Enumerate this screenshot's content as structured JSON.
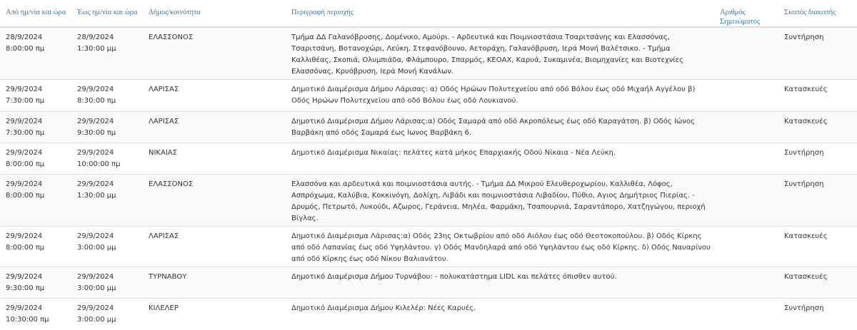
{
  "table": {
    "headers": {
      "from": "Από ημ/νία και ώρα",
      "to": "Έως ημ/νία και ώρα",
      "municipality": "Δήμος/κοινότητα",
      "area": "Περιγραφή περιοχής",
      "notice_number": "Αριθμός Σημειώματος",
      "purpose": "Σκοπός διακοπής"
    },
    "rows": [
      {
        "from_date": "28/9/2024",
        "from_time": "8:00:00 πμ",
        "to_date": "28/9/2024",
        "to_time": "1:30:00 μμ",
        "municipality": "ΕΛΑΣΣΟΝΟΣ",
        "area": "Τμήμα ΔΔ Γαλανόβρυσης, Δομένικο, Αμούρι. - Αρδευτικά και Ποιμνιοστάσια Τσαριτσάνης και Ελασσόνας, Τσαριτσάνη, Βοτανοχώρι, Λεύκη, Στεφανόβουνο, Αετοράχη, Γαλανόβρυση, Ιερά Μονή Βαλέτσικο. - Τμήμα Καλλιθέας, Σκοπιά, Ολυμπιάδα, Φλάμπουρο, Σπαρμός, ΚΕΟΑΧ, Καρυά, Συκαμινέα, Βιομηχανίες και Βιοτεχνίες Ελασσόνας, Κρυόβρυση, Ιερά Μονή Κανάλων.",
        "notice_number": "",
        "purpose": "Συντήρηση"
      },
      {
        "from_date": "29/9/2024",
        "from_time": "7:30:00 πμ",
        "to_date": "29/9/2024",
        "to_time": "8:30:00 πμ",
        "municipality": "ΛΑΡΙΣΑΣ",
        "area": "Δημοτικό Διαμέρισμα Δήμου Λάρισας: α) Οδός Ηρώων Πολυτεχνείου από οδό Βόλου έως οδό Μιχαήλ Αγγέλου β) Οδός Ηρώων Πολυτεχνείου από οδό Βόλου έως οδό Λουκιανού.",
        "notice_number": "",
        "purpose": "Κατασκευές"
      },
      {
        "from_date": "29/9/2024",
        "from_time": "7:30:00 πμ",
        "to_date": "29/9/2024",
        "to_time": "9:30:00 πμ",
        "municipality": "ΛΑΡΙΣΑΣ",
        "area": "Δημοτικό Διαμέρισμα Δήμου Λάρισας:α) Οδός Σαμαρά από οδό Ακροπόλεως έως οδό Καραγάτση. β) Οδός Ιώνος Βαρβάκη από οδός Σαμαρά έως Ιωνος Βαρβάκη 6.",
        "notice_number": "",
        "purpose": "Κατασκευές"
      },
      {
        "from_date": "29/9/2024",
        "from_time": "8:00:00 πμ",
        "to_date": "29/9/2024",
        "to_time": "10:00:00 πμ",
        "municipality": "ΝΙΚΑΙΑΣ",
        "area": "Δημοτικό Διαμέρισμα Νικαίας: πελάτες κατά μήκος Επαρχιακής Οδού Νίκαια - Νέα Λεύκη.",
        "notice_number": "",
        "purpose": "Συντήρηση"
      },
      {
        "from_date": "29/9/2024",
        "from_time": "8:00:00 πμ",
        "to_date": "29/9/2024",
        "to_time": "1:30:00 μμ",
        "municipality": "ΕΛΑΣΣΟΝΟΣ",
        "area": "Ελασσόνα και αρδευτικά και ποιμνιοστάσια αυτής. - Τμήμα ΔΔ Μικρού Ελευθεροχωρίου, Καλλιθέα, Λόφος, Ασπρόχωμα, Καλύβια, Κοκκινόγη, Δολίχη, Λιβάδι και ποιμνιοστάσια Λιβαδίου, Πύθιο, Αγιος Δημήτριος Πιερίας. - Δρυμός, Πετρωτό, Λυκούδι, Αζωρος, Γεράνεια, Μηλέα, Φαρμάκη, Τσαπουρνιά, Σαραντάπορο, Χατζηγώγου, περιοχή Βίγλας.",
        "notice_number": "",
        "purpose": "Συντήρηση"
      },
      {
        "from_date": "29/9/2024",
        "from_time": "8:00:00 πμ",
        "to_date": "29/9/2024",
        "to_time": "3:00:00 μμ",
        "municipality": "ΛΑΡΙΣΑΣ",
        "area": "Δημοτικό Διαμέρισμα Λάρισας:α) Οδός 23ης Οκτωβρίου από οδό Αιόλου έως οδό Θεοτοκοπούλου. β) Οδός Κίρκης από οδό Λαπανίας έως οδό Υψηλάντου. γ) Οδός Μανδηλαρά από οδό Υψηλάντου έως οδό Κίρκης. δ) Οδός Ναυαρίνου από οδό Κίρκης έως οδό Νίκου Βαλιανάτου.",
        "notice_number": "",
        "purpose": "Κατασκευές"
      },
      {
        "from_date": "29/9/2024",
        "from_time": "9:30:00 πμ",
        "to_date": "29/9/2024",
        "to_time": "3:00:00 μμ",
        "municipality": "ΤΥΡΝΑΒΟΥ",
        "area": "Δημοτικό Διαμέρισμα Δήμου Τυρνάβου: - πολυκατάστημα LIDL και πελάτες όπισθεν αυτού.",
        "notice_number": "",
        "purpose": "Κατασκευές"
      },
      {
        "from_date": "29/9/2024",
        "from_time": "10:30:00 πμ",
        "to_date": "29/9/2024",
        "to_time": "3:00:00 μμ",
        "municipality": "ΚΙΛΕΛΕΡ",
        "area": "Δημοτικό Διαμέρισμα Δήμου Κιλελέρ: Νέες Καρυές.",
        "notice_number": "",
        "purpose": "Συντήρηση"
      }
    ]
  }
}
